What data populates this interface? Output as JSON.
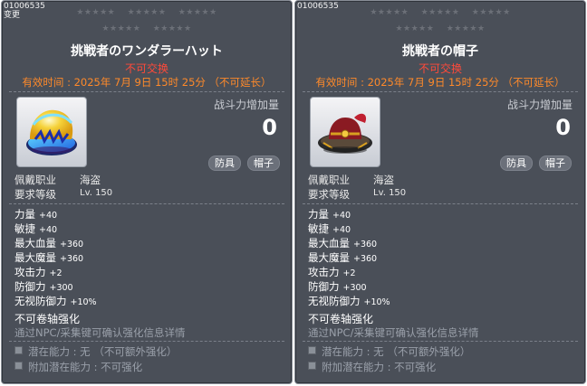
{
  "tooltips": [
    {
      "item_id": "01006535",
      "change": "变更",
      "stars_row1": [
        "★★★★★",
        "★★★★★",
        "★★★★★"
      ],
      "stars_row2": [
        "★★★★★",
        "★★★★★"
      ],
      "title": "挑戦者のワンダラーハット",
      "untradable": "不可交换",
      "expire": "有效时间 :  2025年 7月 9日 15时 25分 （不可延长）",
      "power_label": "战斗力增加量",
      "power_value": "0",
      "badges": [
        "防具",
        "帽子"
      ],
      "job_label": "佩戴职业",
      "job_value": "海盗",
      "level_label": "要求等级",
      "level_value": "Lv. 150",
      "stats": [
        {
          "name": "力量",
          "value": "+40"
        },
        {
          "name": "敏捷",
          "value": "+40"
        },
        {
          "name": "最大血量",
          "value": "+360"
        },
        {
          "name": "最大魔量",
          "value": "+360"
        },
        {
          "name": "攻击力",
          "value": "+2"
        },
        {
          "name": "防御力",
          "value": "+300"
        },
        {
          "name": "无视防御力",
          "value": "+10%"
        }
      ],
      "no_scroll": "不可卷轴强化",
      "npc_note": "通过NPC/采集键可确认强化信息详情",
      "potential": "潜在能力 :  无 （不可额外强化）",
      "additional": "附加潜在能力 :  不可强化"
    },
    {
      "item_id": "01006535",
      "change": "",
      "stars_row1": [
        "★★★★★",
        "★★★★★",
        "★★★★★"
      ],
      "stars_row2": [
        "★★★★★",
        "★★★★★"
      ],
      "title": "挑戦者の帽子",
      "untradable": "不可交换",
      "expire": "有效时间 :  2025年 7月 9日 15时 25分 （不可延长）",
      "power_label": "战斗力增加量",
      "power_value": "0",
      "badges": [
        "防具",
        "帽子"
      ],
      "job_label": "佩戴职业",
      "job_value": "海盗",
      "level_label": "要求等级",
      "level_value": "Lv. 150",
      "stats": [
        {
          "name": "力量",
          "value": "+40"
        },
        {
          "name": "敏捷",
          "value": "+40"
        },
        {
          "name": "最大血量",
          "value": "+360"
        },
        {
          "name": "最大魔量",
          "value": "+360"
        },
        {
          "name": "攻击力",
          "value": "+2"
        },
        {
          "name": "防御力",
          "value": "+300"
        },
        {
          "name": "无视防御力",
          "value": "+10%"
        }
      ],
      "no_scroll": "不可卷轴强化",
      "npc_note": "通过NPC/采集键可确认强化信息详情",
      "potential": "潜在能力 :  无 （不可额外强化）",
      "additional": "附加潜在能力 :  不可强化"
    }
  ],
  "colors": {
    "panel_bg": "#4a4f58",
    "untradable": "#ff4a3a",
    "expire": "#ff8a2a",
    "muted": "#9aa0aa"
  },
  "icons": [
    "wanderer-hat-icon",
    "challenger-hat-icon"
  ]
}
